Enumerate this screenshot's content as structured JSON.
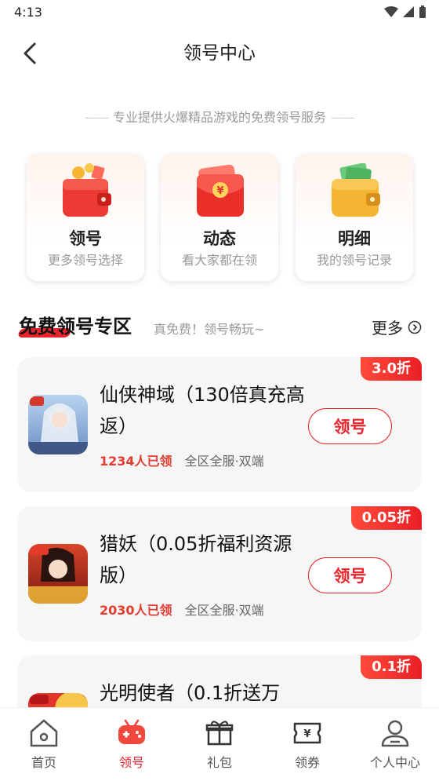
{
  "status_bar": {
    "time": "4:13"
  },
  "nav": {
    "title": "领号中心"
  },
  "slogan": {
    "dash_left": "——",
    "text": "专业提供火爆精品游戏的免费领号服务",
    "dash_right": "——"
  },
  "quick_entries": [
    {
      "title": "领号",
      "subtitle": "更多领号选择",
      "icon": "red-wallet-icon"
    },
    {
      "title": "动态",
      "subtitle": "看大家都在领",
      "icon": "red-envelope-icon"
    },
    {
      "title": "明细",
      "subtitle": "我的领号记录",
      "icon": "gold-wallet-icon"
    }
  ],
  "section": {
    "title": "免费领号专区",
    "subtitle": "真免费！领号畅玩~",
    "more": "更多"
  },
  "games": [
    {
      "name": "仙侠神域（130倍真充高返）",
      "discount": "3.0折",
      "claimed": "1234人已领",
      "range": "全区全服·双端",
      "button": "领号"
    },
    {
      "name": "猎妖（0.05折福利资源版）",
      "discount": "0.05折",
      "claimed": "2030人已领",
      "range": "全区全服·双端",
      "button": "领号"
    },
    {
      "name": "光明使者（0.1折送万",
      "discount": "0.1折"
    }
  ],
  "tabbar": [
    {
      "label": "首页",
      "icon": "home-icon",
      "active": false
    },
    {
      "label": "领号",
      "icon": "gamepad-icon",
      "active": true
    },
    {
      "label": "礼包",
      "icon": "gift-icon",
      "active": false
    },
    {
      "label": "领券",
      "icon": "coupon-icon",
      "active": false
    },
    {
      "label": "个人中心",
      "icon": "profile-icon",
      "active": false
    }
  ],
  "colors": {
    "accent": "#e8242b",
    "card_bg": "#f6f6f6",
    "muted": "#999999"
  }
}
